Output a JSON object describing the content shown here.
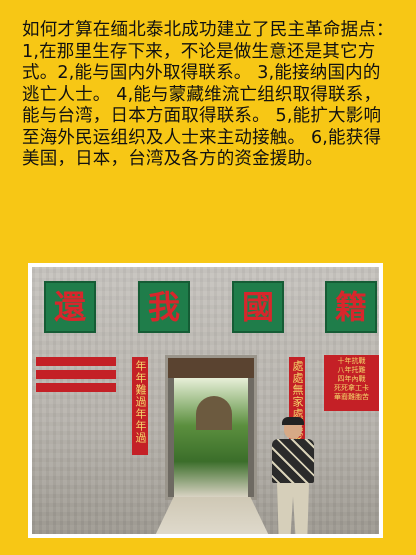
{
  "post": {
    "text": "如何才算在缅北泰北成功建立了民主革命据点：\n1,在那里生存下来，不论是做生意还是其它方式。2,能与国内外取得联系。 3,能接纳国内的逃亡人士。 4,能与蒙藏维流亡组织取得联系，能与台湾，日本方面取得联系。 5,能扩大影响至海外民运组织及人士来主动接触。 6,能获得美国，日本，台湾及各方的资金援助。"
  },
  "photo": {
    "signs": [
      "還",
      "我",
      "國",
      "籍"
    ],
    "couplet_left": "年年難過年年過",
    "couplet_right": "處處無家處處家",
    "notice_right_lines": [
      "十年抗戰",
      "八年托難",
      "四年內戰",
      "死死拿工卡",
      "華裔難胞苦"
    ]
  }
}
